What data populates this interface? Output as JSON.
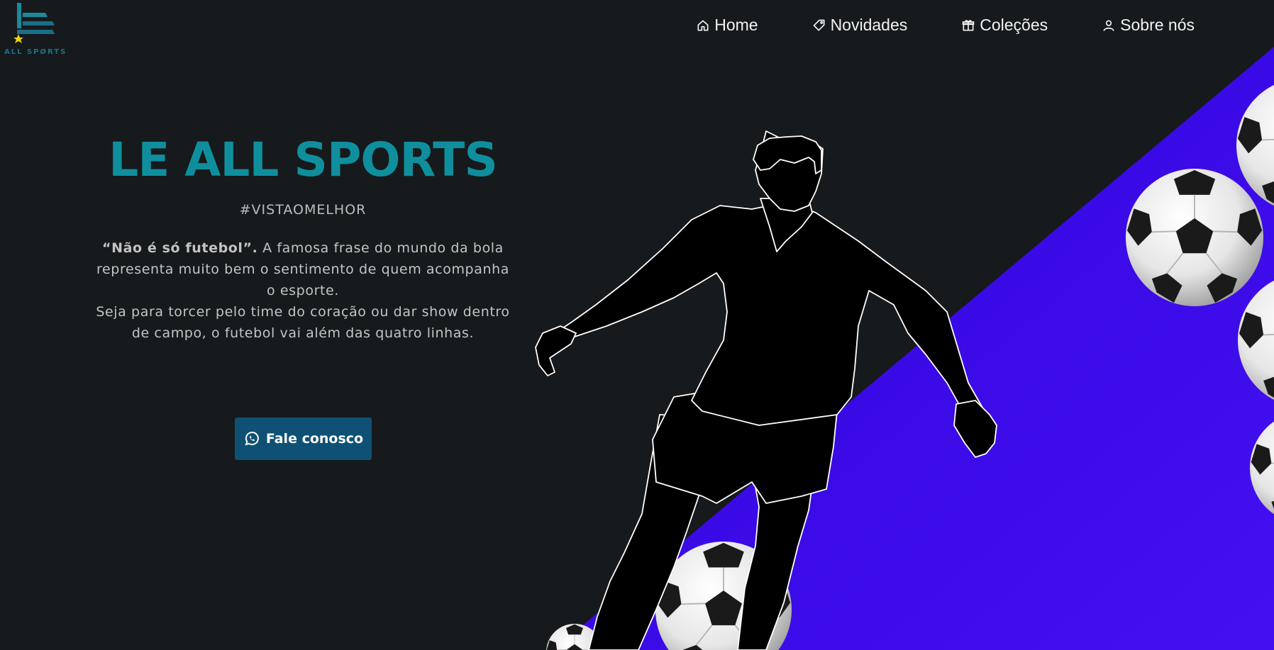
{
  "brand": {
    "logo_text": "ALL SPØRTS"
  },
  "nav": {
    "items": [
      {
        "label": "Home",
        "icon": "home-icon"
      },
      {
        "label": "Novidades",
        "icon": "tag-icon"
      },
      {
        "label": "Coleções",
        "icon": "gift-icon"
      },
      {
        "label": "Sobre nós",
        "icon": "user-icon"
      }
    ]
  },
  "hero": {
    "title": "LE ALL SPORTS",
    "tagline": "#VISTAOMELHOR",
    "quote": "“Não é só futebol”.",
    "description_1": " A famosa frase do mundo da bola representa muito bem o sentimento de quem acompanha o esporte.",
    "description_2": "Seja para torcer pelo time do coração ou dar show dentro de campo, o futebol vai além das quatro linhas.",
    "cta_label": "Fale conosco",
    "cta_icon": "whatsapp-icon"
  },
  "colors": {
    "background": "#161a1c",
    "accent_purple": "#3a0ae6",
    "title_teal": "#0f8f9d",
    "button_blue": "#0e5174"
  },
  "illustration": {
    "figure": "soccer-player-silhouette",
    "balls": "soccer-balls"
  }
}
